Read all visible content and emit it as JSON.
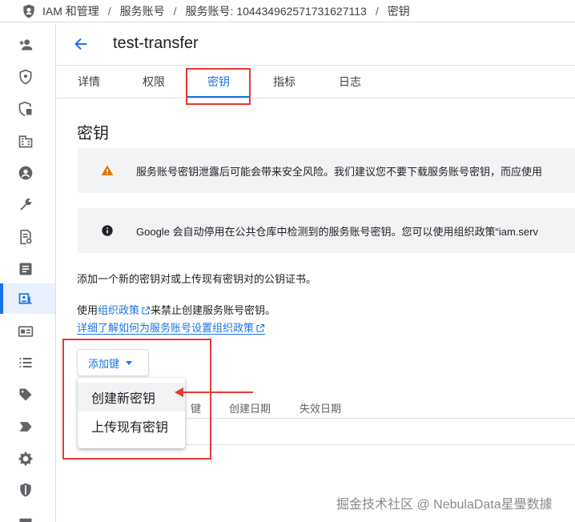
{
  "breadcrumb": {
    "items": [
      "IAM 和管理",
      "服务账号",
      "服务账号: 104434962571731627113",
      "密钥"
    ],
    "separator": "/"
  },
  "rail": {
    "icons": [
      "person-add-icon",
      "security-shield-icon",
      "policy-icon",
      "business-icon",
      "account-circle-icon",
      "wrench-icon",
      "audit-log-icon",
      "notes-icon",
      "service-account-key-icon",
      "card-icon",
      "list-icon",
      "tag-icon",
      "label-arrow-icon",
      "gear-icon",
      "shield-icon",
      "storage-icon"
    ],
    "active_index": 8
  },
  "header": {
    "title": "test-transfer"
  },
  "tabs": [
    {
      "label": "详情"
    },
    {
      "label": "权限"
    },
    {
      "label": "密钥"
    },
    {
      "label": "指标"
    },
    {
      "label": "日志"
    }
  ],
  "section": {
    "title": "密钥",
    "warning_banner": "服务账号密钥泄露后可能会带来安全风险。我们建议您不要下载服务账号密钥，而应使用",
    "info_banner": "Google 会自动停用在公共仓库中检测到的服务账号密钥。您可以使用组织政策“iam.serv",
    "intro": "添加一个新的密钥对或上传现有密钥对的公钥证书。",
    "policy_prefix": "使用",
    "policy_link": "组织政策",
    "policy_suffix": "来禁止创建服务账号密钥。",
    "learn_link": "详细了解如何为服务账号设置组织政策"
  },
  "add_key": {
    "label": "添加键",
    "menu": [
      "创建新密钥",
      "上传现有密钥"
    ]
  },
  "table": {
    "headers": [
      "键",
      "创建日期",
      "失效日期"
    ]
  },
  "watermark": "掘金技术社区 @ NebulaData星璺数據",
  "colors": {
    "accent": "#1a73e8",
    "highlight": "#e53935",
    "warning": "#e37400",
    "banner_bg": "#f1f3f4"
  }
}
